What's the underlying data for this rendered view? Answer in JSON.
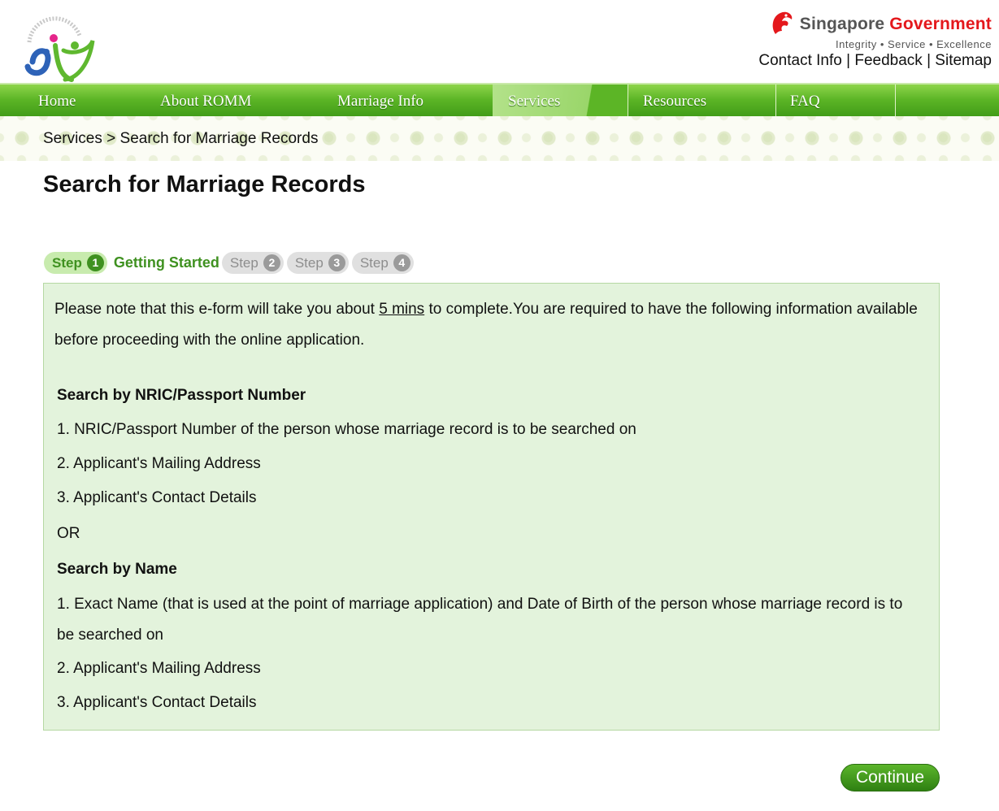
{
  "header": {
    "logo_icon": "romm-logo-icon",
    "logo_ring_text": "REGISTRY OF MUSLIM MARRIAGES",
    "gov_icon": "merlion-icon",
    "gov_name_part1": "Singapore",
    "gov_name_part2": "Government",
    "gov_motto": "Integrity • Service • Excellence",
    "links": {
      "contact": "Contact Info",
      "sep1": " | ",
      "feedback": "Feedback",
      "sep2": " | ",
      "sitemap": "Sitemap"
    }
  },
  "nav": {
    "items": [
      {
        "label": "Home"
      },
      {
        "label": "About ROMM"
      },
      {
        "label": "Marriage Info"
      },
      {
        "label": "Services"
      },
      {
        "label": "Resources"
      },
      {
        "label": "FAQ"
      }
    ],
    "active_index": 3
  },
  "breadcrumb": {
    "parent": "Services",
    "separator": " > ",
    "current": "Search for Marriage Records"
  },
  "page_title": "Search for Marriage Records",
  "steps": {
    "word": "Step",
    "step1_num": "1",
    "step1_label": "Getting Started",
    "step2_num": "2",
    "step3_num": "3",
    "step4_num": "4"
  },
  "info": {
    "intro_pre": "Please note that this e-form will take you about ",
    "intro_duration": "5 mins",
    "intro_post": " to complete.You are required to have the following information available before proceeding with the online application.",
    "nric_heading": "Search by NRIC/Passport Number",
    "nric_items": [
      "1. NRIC/Passport Number of the person whose marriage record is to be searched on",
      "2. Applicant's Mailing Address",
      "3. Applicant's Contact Details"
    ],
    "or_text": "OR",
    "name_heading": "Search by Name",
    "name_items": [
      "1. Exact Name (that is used at the point of marriage application) and Date of Birth of the person whose marriage record is to be searched on",
      "2. Applicant's Mailing Address",
      "3. Applicant's Contact Details"
    ]
  },
  "continue_label": "Continue",
  "colors": {
    "nav_green": "#5cb526",
    "box_bg": "#e3f3dc",
    "step_active": "#3f9120",
    "gov_red": "#e4181c"
  }
}
